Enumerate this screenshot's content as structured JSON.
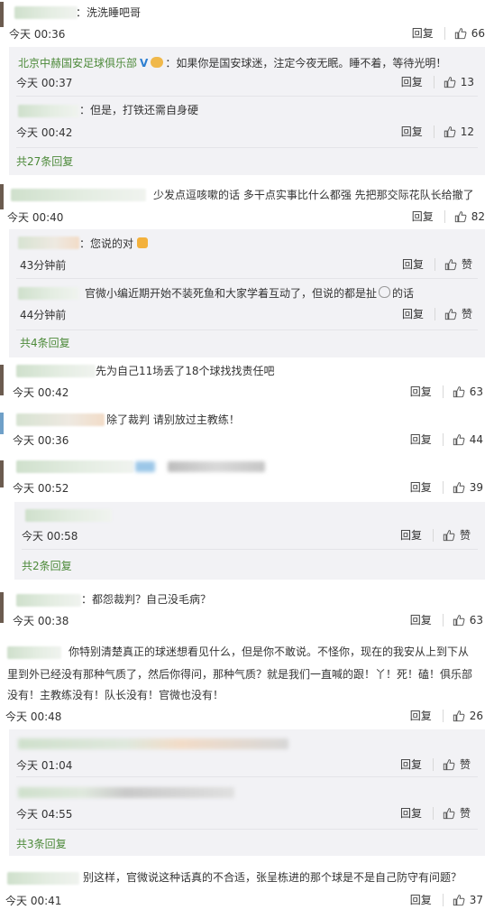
{
  "actions": {
    "reply": "回复",
    "like_label": "赞"
  },
  "c1": {
    "text": "：洗洗睡吧哥",
    "time": "今天 00:36",
    "likes": "66"
  },
  "c1_replies": [
    {
      "name": "北京中赫国安足球俱乐部",
      "text": "：如果你是国安球迷，注定今夜无眠。睡不着，等待光明！",
      "time": "今天 00:37",
      "likes": "13"
    },
    {
      "text": "：但是，打铁还需自身硬",
      "time": "今天 00:42",
      "likes": "12"
    }
  ],
  "c1_more": "共27条回复",
  "c2": {
    "text": "少发点逗咳嗽的话 多干点实事比什么都强 先把那交际花队长给撤了",
    "time": "今天 00:40",
    "likes": "82"
  },
  "c2_replies": [
    {
      "text": "：您说的对",
      "time": "43分钟前"
    },
    {
      "text": "官微小编近期开始不装死鱼和大家学着互动了，但说的都是扯",
      "text_tail": "的话",
      "time": "44分钟前"
    }
  ],
  "c2_more": "共4条回复",
  "c3": {
    "text": "先为自己11场丢了18个球找找责任吧",
    "time": "今天 00:42",
    "likes": "63"
  },
  "c4": {
    "text": "除了裁判 请别放过主教练！",
    "time": "今天 00:36",
    "likes": "44"
  },
  "c5": {
    "time": "今天 00:52",
    "likes": "39"
  },
  "c5_replies": [
    {
      "time": "今天 00:58"
    }
  ],
  "c5_more": "共2条回复",
  "c6": {
    "text": "：都怨裁判？自己没毛病？",
    "time": "今天 00:38",
    "likes": "63"
  },
  "c7": {
    "line1": "你特别清楚真正的球迷想看见什么，但是你不敢说。不怪你，现在的我安从上到下从",
    "line2": "里到外已经没有那种气质了，然后你得问，那种气质？就是我们一直喊的跟！丫！死！磕！俱乐部",
    "line3": "没有！主教练没有！队长没有！官微也没有！",
    "time": "今天 00:48",
    "likes": "26"
  },
  "c7_replies": [
    {
      "time": "今天 01:04"
    },
    {
      "time": "今天 04:55"
    }
  ],
  "c7_more": "共3条回复",
  "c8": {
    "text": "别这样，官微说这种话真的不合适，张呈栋进的那个球是不是自己防守有问题？",
    "time": "今天 00:41",
    "likes": "37"
  },
  "colors": {
    "accent_green": "#4d8a3a",
    "verified_blue": "#2d7fd1",
    "panel_bg": "#f2f2f5"
  }
}
